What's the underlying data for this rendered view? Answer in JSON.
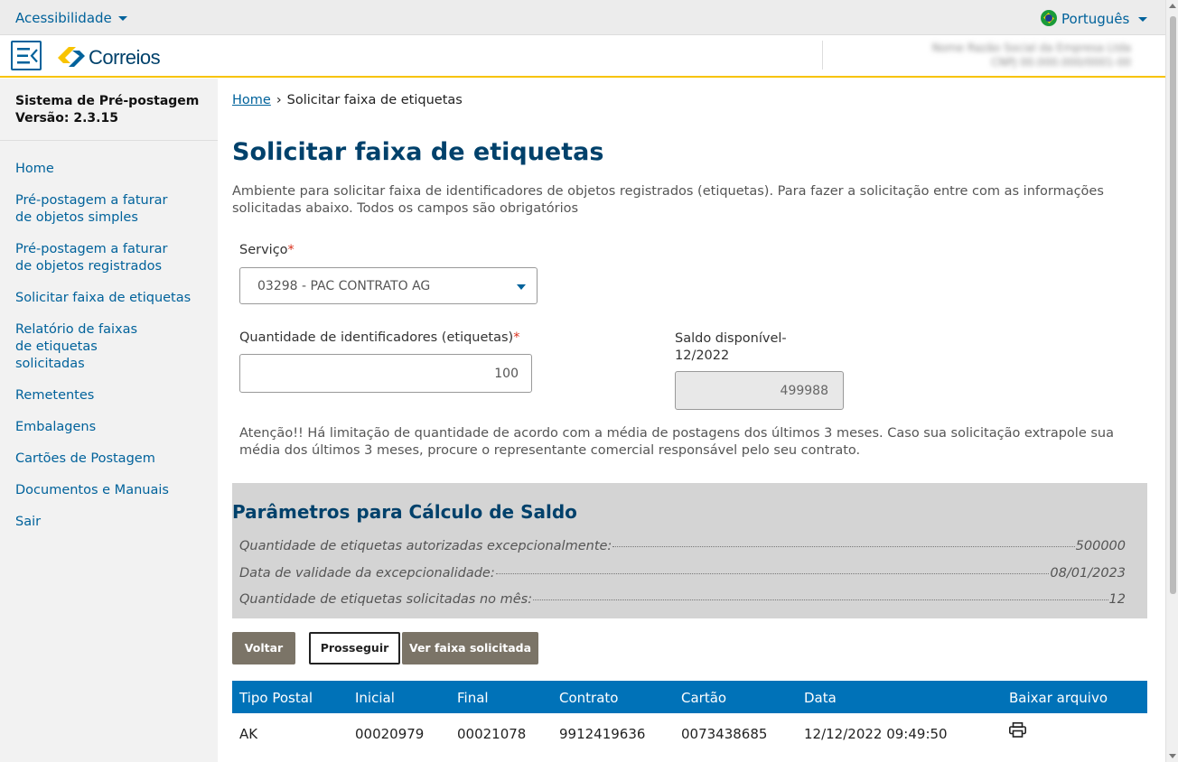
{
  "topbar": {
    "accessibility": "Acessibilidade",
    "language": "Português"
  },
  "header": {
    "logo_text": "Correios",
    "user_line1": "Nome Razão Social da Empresa Ltda",
    "user_line2": "CNPJ 00.000.000/0001-00"
  },
  "sidebar": {
    "system_name": "Sistema de Pré-postagem",
    "version": "Versão: 2.3.15",
    "items": [
      {
        "label": "Home"
      },
      {
        "label": "Pré-postagem a faturar de objetos simples"
      },
      {
        "label": "Pré-postagem a faturar de objetos registrados"
      },
      {
        "label": "Solicitar faixa de etiquetas"
      },
      {
        "label": "Relatório de faixas de etiquetas solicitadas"
      },
      {
        "label": "Remetentes"
      },
      {
        "label": "Embalagens"
      },
      {
        "label": "Cartões de Postagem"
      },
      {
        "label": "Documentos e Manuais"
      },
      {
        "label": "Sair"
      }
    ]
  },
  "breadcrumb": {
    "home": "Home",
    "separator": "›",
    "current": "Solicitar faixa de etiquetas"
  },
  "page": {
    "title": "Solicitar faixa de etiquetas",
    "description": "Ambiente para solicitar faixa de identificadores de objetos registrados (etiquetas). Para fazer a solicitação entre com as informações solicitadas abaixo. Todos os campos são obrigatórios"
  },
  "form": {
    "service_label": "Serviço",
    "service_value": "03298 - PAC CONTRATO AG",
    "quantity_label": "Quantidade de identificadores (etiquetas)",
    "quantity_value": "100",
    "balance_label": "Saldo disponível-",
    "balance_period": "12/2022",
    "balance_value": "499988",
    "required_mark": "*"
  },
  "warning": "Atenção!! Há limitação de quantidade de acordo com a média de postagens dos últimos 3 meses. Caso sua solicitação extrapole sua média dos últimos 3 meses, procure o representante comercial responsável pelo seu contrato.",
  "params": {
    "title": "Parâmetros para Cálculo de Saldo",
    "rows": [
      {
        "label": "Quantidade de etiquetas autorizadas excepcionalmente:",
        "value": "500000"
      },
      {
        "label": "Data de validade da excepcionalidade:",
        "value": "08/01/2023"
      },
      {
        "label": "Quantidade de etiquetas solicitadas no mês:",
        "value": "12"
      }
    ]
  },
  "buttons": {
    "back": "Voltar",
    "next": "Prosseguir",
    "view": "Ver faixa solicitada"
  },
  "table": {
    "headers": [
      "Tipo Postal",
      "Inicial",
      "Final",
      "Contrato",
      "Cartão",
      "Data",
      "Baixar arquivo"
    ],
    "rows": [
      [
        "AK",
        "00020979",
        "00021078",
        "9912419636",
        "0073438685",
        "12/12/2022 09:49:50"
      ]
    ]
  },
  "colors": {
    "primary": "#00629b",
    "title": "#00416b",
    "accent": "#f8c300",
    "table_header": "#0072b8",
    "button": "#7b7467"
  }
}
